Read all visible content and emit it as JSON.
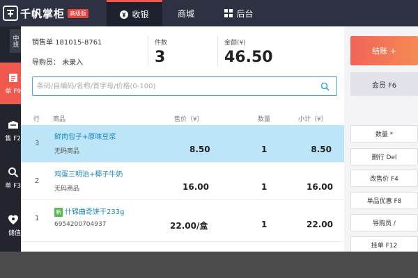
{
  "brand": {
    "name": "千帆掌柜",
    "badge": "高级版"
  },
  "nav": {
    "tabs": [
      {
        "label": "收银",
        "icon": "yuan-circle-icon",
        "active": true
      },
      {
        "label": "商城",
        "icon": "",
        "active": false
      },
      {
        "label": "后台",
        "icon": "grid-icon",
        "active": false
      }
    ]
  },
  "sidebar": {
    "shift": "中班",
    "items": [
      {
        "label": "单 F9",
        "icon": "order-icon",
        "active": true
      },
      {
        "label": "售 F2",
        "icon": "inventory-icon",
        "active": false
      },
      {
        "label": "单 F3",
        "icon": "search-icon",
        "active": false
      },
      {
        "label": "储值",
        "icon": "recharge-icon",
        "active": false
      }
    ]
  },
  "order": {
    "number_label": "销售单",
    "number": "181015-8761",
    "guide_label": "导购员：",
    "guide": "未录入",
    "qty_label": "件数",
    "qty": "3",
    "total_label": "金额(¥)",
    "total": "46.50"
  },
  "search": {
    "placeholder": "条码/自编码/名称/首字母/价格(0-100)"
  },
  "table": {
    "headers": {
      "row": "行",
      "product": "商品",
      "price": "售价（¥）",
      "qty": "数量",
      "subtotal": "小计（¥）"
    },
    "rows": [
      {
        "no": "3",
        "name": "鲜肉包子+原味豆浆",
        "sub": "无码商品",
        "price": "8.50",
        "qty": "1",
        "subtotal": "8.50",
        "is_new": false,
        "selected": true
      },
      {
        "no": "2",
        "name": "鸡蛋三明治+椰子牛奶",
        "sub": "无码商品",
        "price": "16.00",
        "qty": "1",
        "subtotal": "16.00",
        "is_new": false,
        "selected": false
      },
      {
        "no": "1",
        "name": "什锦曲奇饼干233g",
        "sub": "6954200704937",
        "price": "22.00/盒",
        "qty": "1",
        "subtotal": "22.00",
        "is_new": true,
        "new_label": "新",
        "selected": false
      }
    ]
  },
  "actions": {
    "checkout": "结账 +",
    "member": "会员 F6",
    "buttons": [
      "数量 *",
      "删行 Del",
      "改售价 F4",
      "单品优惠 F8",
      "导购员 /",
      "挂单 F12"
    ]
  },
  "colors": {
    "accent": "#f0594d",
    "nav_bg": "#2d3142",
    "sidebar_bg": "#23252e",
    "link": "#1a86b9",
    "selected_row": "#bde5f8"
  }
}
